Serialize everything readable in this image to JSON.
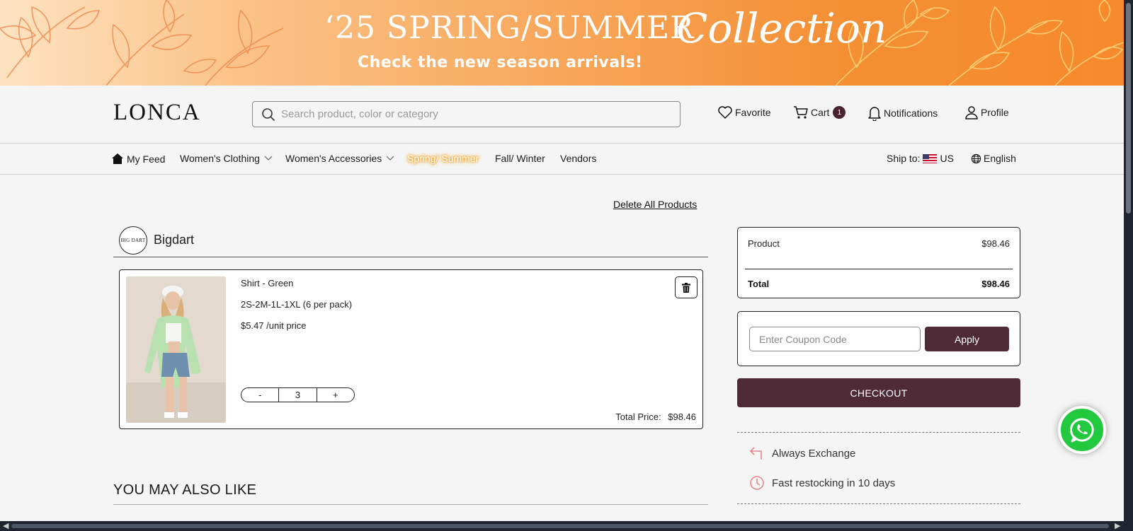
{
  "banner": {
    "title": "‘25 SPRING/SUMMER",
    "script": "Collection",
    "subtitle": "Check the new season arrivals!"
  },
  "header": {
    "logo": "LONCA",
    "search_placeholder": "Search product, color or category",
    "favorite_label": "Favorite",
    "cart_label": "Cart",
    "cart_count": "1",
    "notifications_label": "Notifications",
    "profile_label": "Profile"
  },
  "nav": {
    "my_feed": "My Feed",
    "womens_clothing": "Women's Clothing",
    "womens_accessories": "Women's Accessories",
    "spring_summer": "Spring/ Summer",
    "fall_winter": "Fall/ Winter",
    "vendors": "Vendors",
    "ship_to_label": "Ship to:",
    "ship_to_country": "US",
    "language": "English"
  },
  "cart": {
    "delete_all_label": "Delete All Products",
    "vendor_logo_text": "BIG DART",
    "vendor_name": "Bigdart",
    "item": {
      "name": "Shirt - Green",
      "sizes": "2S-2M-1L-1XL (6 per pack)",
      "unit_price": "$5.47 /unit price",
      "quantity": "3",
      "minus_label": "-",
      "plus_label": "+",
      "total_label": "Total Price:",
      "total_value": "$98.46"
    },
    "also_like_title": "YOU MAY ALSO LIKE"
  },
  "summary": {
    "product_label": "Product",
    "product_value": "$98.46",
    "total_label": "Total",
    "total_value": "$98.46",
    "coupon_placeholder": "Enter Coupon Code",
    "apply_label": "Apply",
    "checkout_label": "CHECKOUT",
    "perk_exchange": "Always Exchange",
    "perk_restock": "Fast restocking in 10 days"
  },
  "colors": {
    "brand_primary": "#4e2a36",
    "whatsapp_green": "#22c93e",
    "perk_icon": "#e8868a"
  },
  "icons": {
    "search": "search-icon",
    "favorite": "heart-icon",
    "cart": "cart-icon",
    "notifications": "bell-icon",
    "profile": "user-icon",
    "home": "home-icon",
    "language": "globe-icon",
    "delete": "trash-icon",
    "exchange": "return-arrow-icon",
    "restock": "clock-icon",
    "chat": "whatsapp-icon"
  }
}
